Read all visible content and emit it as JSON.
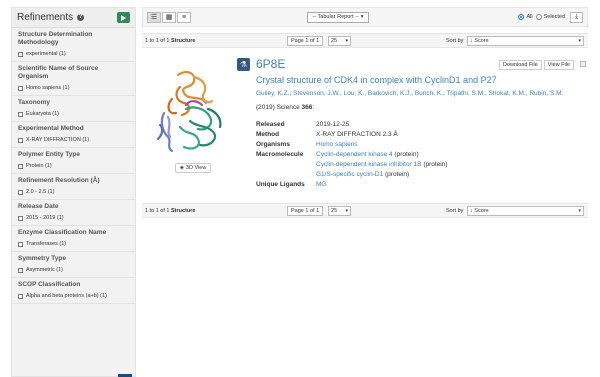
{
  "sidebar": {
    "title": "Refinements",
    "facets": [
      {
        "title": "Structure Determination Methodology",
        "items": [
          "experimental (1)"
        ]
      },
      {
        "title": "Scientific Name of Source Organism",
        "items": [
          "Homo sapiens (1)"
        ]
      },
      {
        "title": "Taxonomy",
        "items": [
          "Eukaryota (1)"
        ]
      },
      {
        "title": "Experimental Method",
        "items": [
          "X-RAY DIFFRACTION (1)"
        ]
      },
      {
        "title": "Polymer Entity Type",
        "items": [
          "Protein (1)"
        ]
      },
      {
        "title": "Refinement Resolution (Å)",
        "items": [
          "2.0 - 2.5 (1)"
        ]
      },
      {
        "title": "Release Date",
        "items": [
          "2015 - 2019 (1)"
        ]
      },
      {
        "title": "Enzyme Classification Name",
        "items": [
          "Transferases (1)"
        ]
      },
      {
        "title": "Symmetry Type",
        "items": [
          "Asymmetric (1)"
        ]
      },
      {
        "title": "SCOP Classification",
        "items": [
          "Alpha and beta proteins (a+b) (1)"
        ]
      }
    ]
  },
  "toolbar": {
    "report_select": "-- Tabular Report --",
    "radio_all": "All",
    "radio_selected": "Selected"
  },
  "pager": {
    "summary_prefix": "1 to 1 of 1",
    "summary_bold": "Structure",
    "page_label": "Page 1 of 1",
    "per_page": "25",
    "sort_by": "Sort by",
    "sort_value": "↓ Score"
  },
  "result": {
    "pdb_id": "6P8E",
    "title": "Crystal structure of CDK4 in complex with CyclinD1 and P27",
    "authors": "Guiley, K.Z., Stevenson, J.W., Lou, K., Barkovich, K.J., Bunch, K., Tripathi, S.M., Shokat, K.M., Rubin, S.M.",
    "citation_prefix": "(2019) Science",
    "citation_volume": "366",
    "citation_suffix": ":",
    "download_file": "Download File",
    "view_file": "View File",
    "view3d": "3D View",
    "released_label": "Released",
    "released": "2019-12-25",
    "method_label": "Method",
    "method": "X-RAY DIFFRACTION 2.3 Å",
    "organisms_label": "Organisms",
    "organisms": "Homo sapiens",
    "macromolecule_label": "Macromolecule",
    "macromolecules": [
      {
        "name": "Cyclin-dependent kinase 4",
        "type": "(protein)"
      },
      {
        "name": "Cyclin-dependent kinase inhibitor 1B",
        "type": "(protein)"
      },
      {
        "name": "G1/S-specific cyclin-D1",
        "type": "(protein)"
      }
    ],
    "ligands_label": "Unique Ligands",
    "ligands": "MG"
  },
  "colors": {
    "link": "#3b7fc4",
    "flask": "#34587f",
    "play": "#2e8b57"
  }
}
